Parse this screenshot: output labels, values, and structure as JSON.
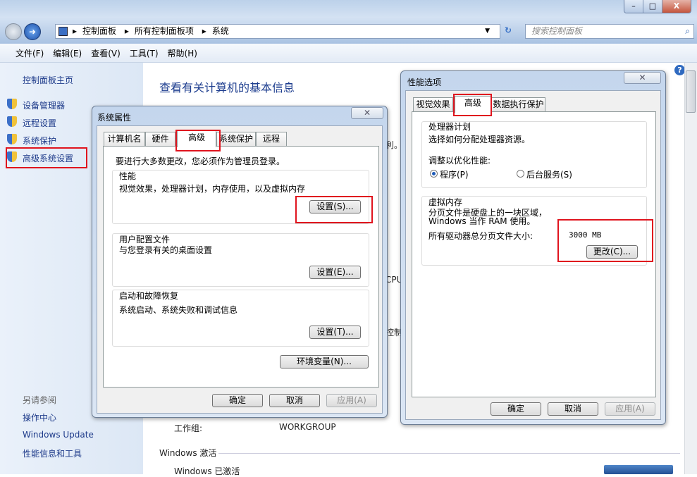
{
  "window": {
    "controls": {
      "minimize": "–",
      "maximize": "□",
      "close": "X"
    }
  },
  "nav": {
    "breadcrumb": [
      "控制面板",
      "所有控制面板项",
      "系统"
    ],
    "search_placeholder": "搜索控制面板"
  },
  "menu": [
    "文件(F)",
    "编辑(E)",
    "查看(V)",
    "工具(T)",
    "帮助(H)"
  ],
  "sidebar": {
    "home": "控制面板主页",
    "items": [
      "设备管理器",
      "远程设置",
      "系统保护",
      "高级系统设置"
    ],
    "see_also": "另请参阅",
    "links": [
      "操作中心",
      "Windows Update",
      "性能信息和工具"
    ]
  },
  "main": {
    "title": "查看有关计算机的基本信息",
    "frag1": "利。",
    "frag2": "CPU",
    "frag3": "控制",
    "workgroup_label": "工作组:",
    "workgroup_value": "WORKGROUP",
    "activation_header": "Windows 激活",
    "activation_status": "Windows 已激活"
  },
  "sysprops": {
    "title": "系统属性",
    "close": "✕",
    "tabs": [
      "计算机名",
      "硬件",
      "高级",
      "系统保护",
      "远程"
    ],
    "admin_note": "要进行大多数更改，您必须作为管理员登录。",
    "groups": [
      {
        "title": "性能",
        "desc": "视觉效果，处理器计划，内存使用，以及虚拟内存",
        "button": "设置(S)..."
      },
      {
        "title": "用户配置文件",
        "desc": "与您登录有关的桌面设置",
        "button": "设置(E)..."
      },
      {
        "title": "启动和故障恢复",
        "desc": "系统启动、系统失败和调试信息",
        "button": "设置(T)..."
      }
    ],
    "env_button": "环境变量(N)...",
    "ok": "确定",
    "cancel": "取消",
    "apply": "应用(A)"
  },
  "perf": {
    "title": "性能选项",
    "close": "✕",
    "tabs": [
      "视觉效果",
      "高级",
      "数据执行保护"
    ],
    "cpu_group": "处理器计划",
    "cpu_desc": "选择如何分配处理器资源。",
    "optimize": "调整以优化性能:",
    "radio_programs": "程序(P)",
    "radio_services": "后台服务(S)",
    "selected": "程序(P)",
    "vm_group": "虚拟内存",
    "vm_desc": "分页文件是硬盘上的一块区域，Windows 当作 RAM 使用。",
    "vm_total_label": "所有驱动器总分页文件大小:",
    "vm_total_value": "3000 MB",
    "change_button": "更改(C)...",
    "ok": "确定",
    "cancel": "取消",
    "apply": "应用(A)"
  },
  "colors": {
    "highlight": "#e0141e",
    "link": "#1e3b8a"
  }
}
